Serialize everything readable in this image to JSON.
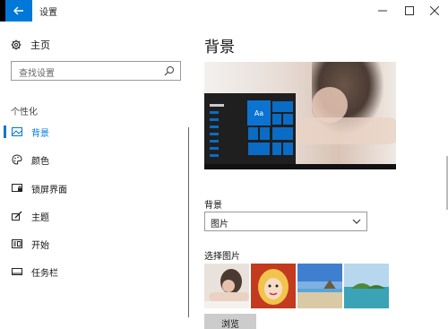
{
  "window": {
    "title": "设置",
    "controls": {
      "minimize": "—",
      "maximize": "☐",
      "close": "✕"
    }
  },
  "sidebar": {
    "home_label": "主页",
    "search": {
      "placeholder": "查找设置"
    },
    "section_title": "个性化",
    "items": [
      {
        "label": "背景",
        "icon": "picture-icon",
        "active": true
      },
      {
        "label": "颜色",
        "icon": "palette-icon",
        "active": false
      },
      {
        "label": "锁屏界面",
        "icon": "lock-screen-icon",
        "active": false
      },
      {
        "label": "主题",
        "icon": "brush-icon",
        "active": false
      },
      {
        "label": "开始",
        "icon": "start-menu-icon",
        "active": false
      },
      {
        "label": "任务栏",
        "icon": "taskbar-icon",
        "active": false
      }
    ]
  },
  "main": {
    "title": "背景",
    "preview": {
      "tile_text": "Aa"
    },
    "background_label": "背景",
    "background_select": {
      "value": "图片"
    },
    "choose_picture_label": "选择图片",
    "thumbnails": [
      "thumb-woman",
      "thumb-cartoon-girl",
      "thumb-beach",
      "thumb-island"
    ],
    "browse_button": "浏览"
  },
  "colors": {
    "accent": "#0078d7"
  }
}
